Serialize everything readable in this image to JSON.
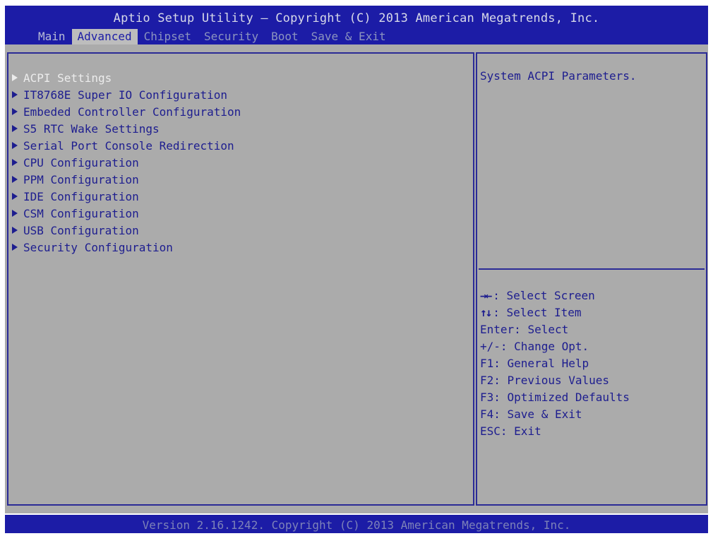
{
  "header": {
    "title": "Aptio Setup Utility – Copyright (C) 2013 American Megatrends, Inc.",
    "tabs": [
      {
        "label": "Main"
      },
      {
        "label": "Advanced"
      },
      {
        "label": "Chipset"
      },
      {
        "label": "Security"
      },
      {
        "label": "Boot"
      },
      {
        "label": "Save & Exit"
      }
    ],
    "active_tab": "Advanced"
  },
  "menu": {
    "items": [
      {
        "label": "ACPI Settings",
        "selected": true
      },
      {
        "label": "IT8768E Super IO Configuration"
      },
      {
        "label": "Embeded Controller Configuration"
      },
      {
        "label": "S5 RTC Wake Settings"
      },
      {
        "label": "Serial Port Console Redirection"
      },
      {
        "label": "CPU Configuration"
      },
      {
        "label": "PPM Configuration"
      },
      {
        "label": "IDE Configuration"
      },
      {
        "label": "CSM Configuration"
      },
      {
        "label": "USB Configuration"
      },
      {
        "label": "Security Configuration"
      }
    ]
  },
  "help": {
    "description": "System ACPI Parameters.",
    "keys": [
      {
        "key": "→←",
        "text": ": Select Screen"
      },
      {
        "key": "↑↓",
        "text": ": Select Item"
      },
      {
        "key": "Enter",
        "text": ": Select"
      },
      {
        "key": "+/-",
        "text": ": Change Opt."
      },
      {
        "key": "F1",
        "text": ": General Help"
      },
      {
        "key": "F2",
        "text": ": Previous Values"
      },
      {
        "key": "F3",
        "text": ": Optimized Defaults"
      },
      {
        "key": "F4",
        "text": ": Save & Exit"
      },
      {
        "key": "ESC",
        "text": ": Exit"
      }
    ]
  },
  "footer": {
    "version": "Version 2.16.1242. Copyright (C) 2013 American Megatrends, Inc."
  },
  "colors": {
    "bar": "#1c1ca6",
    "panel": "#ababab",
    "text": "#1d1d8f",
    "selected_text": "#ececec",
    "active_tab_bg": "#bdbdbd"
  },
  "icons": {
    "submenu": "submenu-arrow-icon"
  }
}
